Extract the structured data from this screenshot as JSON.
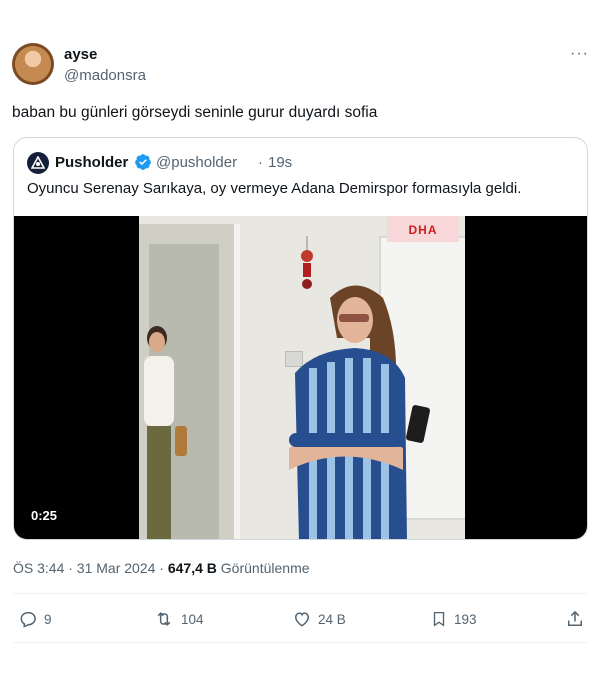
{
  "tweet": {
    "display_name": "ayse",
    "handle": "@madonsra",
    "more": "···",
    "text": "baban bu günleri görseydi seninle gurur duyardı sofia"
  },
  "quote": {
    "display_name": "Pusholder",
    "handle": "@pusholder",
    "separator": "·",
    "time": "19s",
    "text": "Oyuncu Serenay Sarıkaya, oy vermeye Adana Demirspor formasıyla geldi.",
    "media": {
      "duration": "0:25",
      "watermark": "DHA"
    }
  },
  "meta": {
    "timestamp": "ÖS 3:44 · 31 Mar 2024 ·",
    "views_count": "647,4 B",
    "views_label": "Görüntülenme"
  },
  "actions": {
    "reply": "9",
    "retweet": "104",
    "like": "24 B",
    "bookmark": "193"
  },
  "colors": {
    "verified": "#1d9bf0",
    "secondary_text": "#536471",
    "border": "#cfd9de"
  }
}
